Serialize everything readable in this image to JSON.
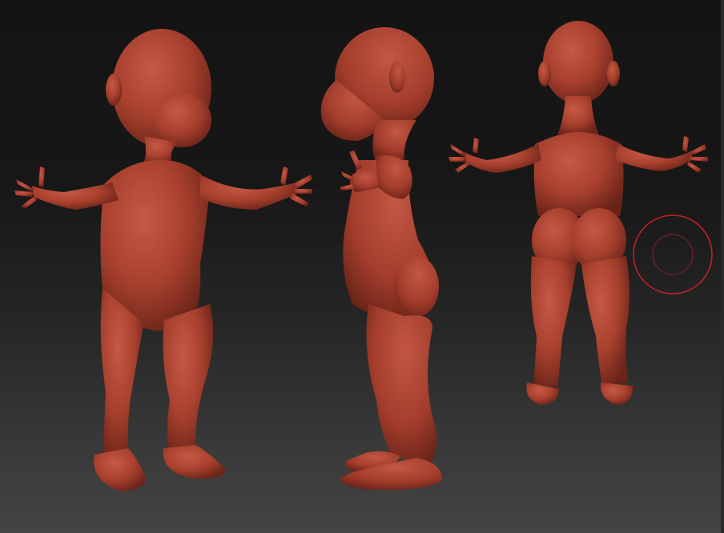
{
  "app": {
    "name": ""
  },
  "viewport": {
    "background_top": "#141414",
    "background_bottom": "#444444"
  },
  "model": {
    "material_color": "#a8402e",
    "material_highlight": "#c55a45",
    "material_shadow": "#6a2418",
    "views": [
      "front-three-quarter",
      "side",
      "back"
    ]
  },
  "brush_cursor": {
    "outer_color": "#c8202a",
    "inner_color": "#8a2028"
  }
}
